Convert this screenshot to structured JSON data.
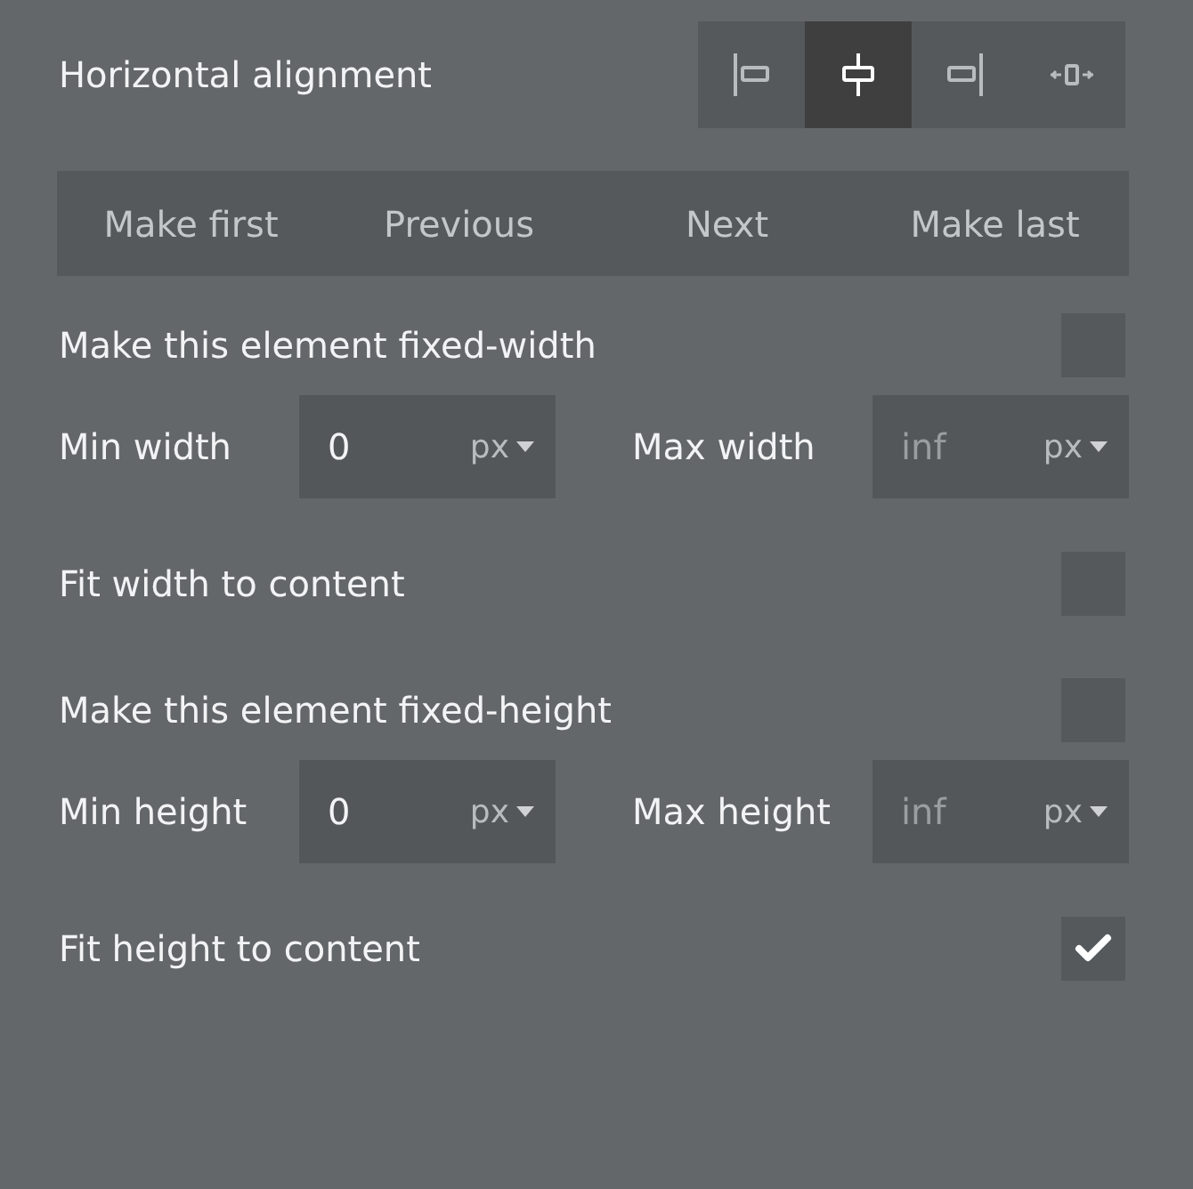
{
  "rows": [
    {
      "kind": "align",
      "label": "Horizontal alignment",
      "options": [
        {
          "kind": "left",
          "selected": false
        },
        {
          "kind": "center",
          "selected": true
        },
        {
          "kind": "right",
          "selected": false
        },
        {
          "kind": "stretch",
          "selected": false
        }
      ]
    },
    {
      "kind": "nav",
      "buttons": [
        "Make first",
        "Previous",
        "Next",
        "Make last"
      ]
    },
    {
      "kind": "checkbox",
      "label": "Make this element fixed-width",
      "checked": false
    },
    {
      "kind": "size",
      "fields": [
        {
          "label": "Min width",
          "value": "0",
          "unit": "px"
        },
        {
          "label": "Max width",
          "placeholder": "inf",
          "unit": "px"
        }
      ]
    },
    {
      "kind": "checkbox",
      "label": "Fit width to content",
      "checked": false
    },
    {
      "kind": "checkbox",
      "label": "Make this element fixed-height",
      "checked": false
    },
    {
      "kind": "size",
      "fields": [
        {
          "label": "Min height",
          "value": "0",
          "unit": "px"
        },
        {
          "label": "Max height",
          "placeholder": "inf",
          "unit": "px"
        }
      ]
    },
    {
      "kind": "checkbox",
      "label": "Fit height to content",
      "checked": true
    }
  ]
}
